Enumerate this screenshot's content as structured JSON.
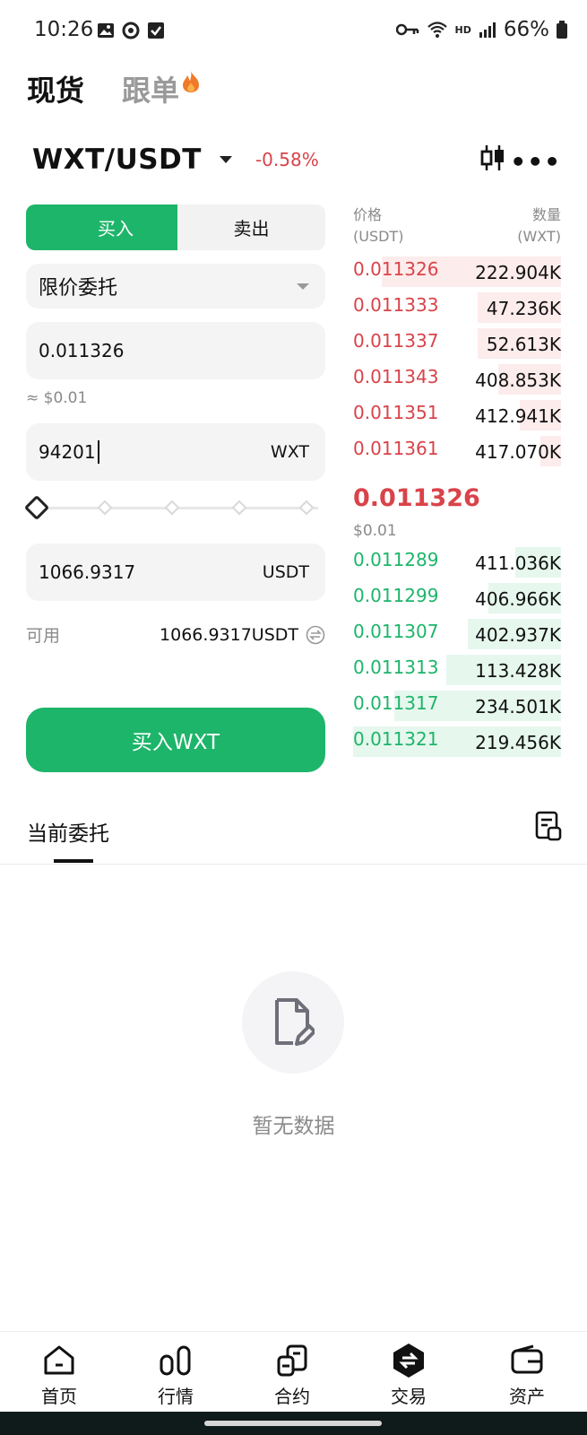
{
  "status": {
    "time": "10:26",
    "battery": "66%",
    "network": "HD"
  },
  "top_tabs": {
    "spot": "现货",
    "copy_trade": "跟单"
  },
  "pair": {
    "name": "WXT/USDT",
    "change": "-0.58%"
  },
  "order_form": {
    "buy_label": "买入",
    "sell_label": "卖出",
    "order_type": "限价委托",
    "price_value": "0.011326",
    "price_approx": "≈ $0.01",
    "quantity_value": "94201",
    "quantity_unit": "WXT",
    "slider_percent": 0,
    "total_value": "1066.9317",
    "total_unit": "USDT",
    "available_label": "可用",
    "available_value": "1066.9317USDT",
    "submit_label": "买入WXT"
  },
  "order_book": {
    "price_header": "价格",
    "price_unit": "(USDT)",
    "amount_header": "数量",
    "amount_unit": "(WXT)",
    "asks": [
      {
        "price": "0.011326",
        "amount": "222.904K",
        "depth": 0.86
      },
      {
        "price": "0.011333",
        "amount": "47.236K",
        "depth": 0.4
      },
      {
        "price": "0.011337",
        "amount": "52.613K",
        "depth": 0.4
      },
      {
        "price": "0.011343",
        "amount": "408.853K",
        "depth": 0.3
      },
      {
        "price": "0.011351",
        "amount": "412.941K",
        "depth": 0.2
      },
      {
        "price": "0.011361",
        "amount": "417.070K",
        "depth": 0.1
      }
    ],
    "last_price": "0.011326",
    "last_price_fiat": "$0.01",
    "bids": [
      {
        "price": "0.011289",
        "amount": "411.036K",
        "depth": 0.22
      },
      {
        "price": "0.011299",
        "amount": "406.966K",
        "depth": 0.35
      },
      {
        "price": "0.011307",
        "amount": "402.937K",
        "depth": 0.45
      },
      {
        "price": "0.011313",
        "amount": "113.428K",
        "depth": 0.55
      },
      {
        "price": "0.011317",
        "amount": "234.501K",
        "depth": 0.8
      },
      {
        "price": "0.011321",
        "amount": "219.456K",
        "depth": 1.0
      }
    ]
  },
  "orders": {
    "tab_label": "当前委托",
    "empty_text": "暂无数据"
  },
  "bottom_nav": [
    {
      "label": "首页",
      "icon": "home-icon"
    },
    {
      "label": "行情",
      "icon": "market-icon"
    },
    {
      "label": "合约",
      "icon": "futures-icon"
    },
    {
      "label": "交易",
      "icon": "trade-icon"
    },
    {
      "label": "资产",
      "icon": "wallet-icon"
    }
  ],
  "colors": {
    "accent_green": "#1db56a",
    "accent_red": "#d9434a"
  }
}
